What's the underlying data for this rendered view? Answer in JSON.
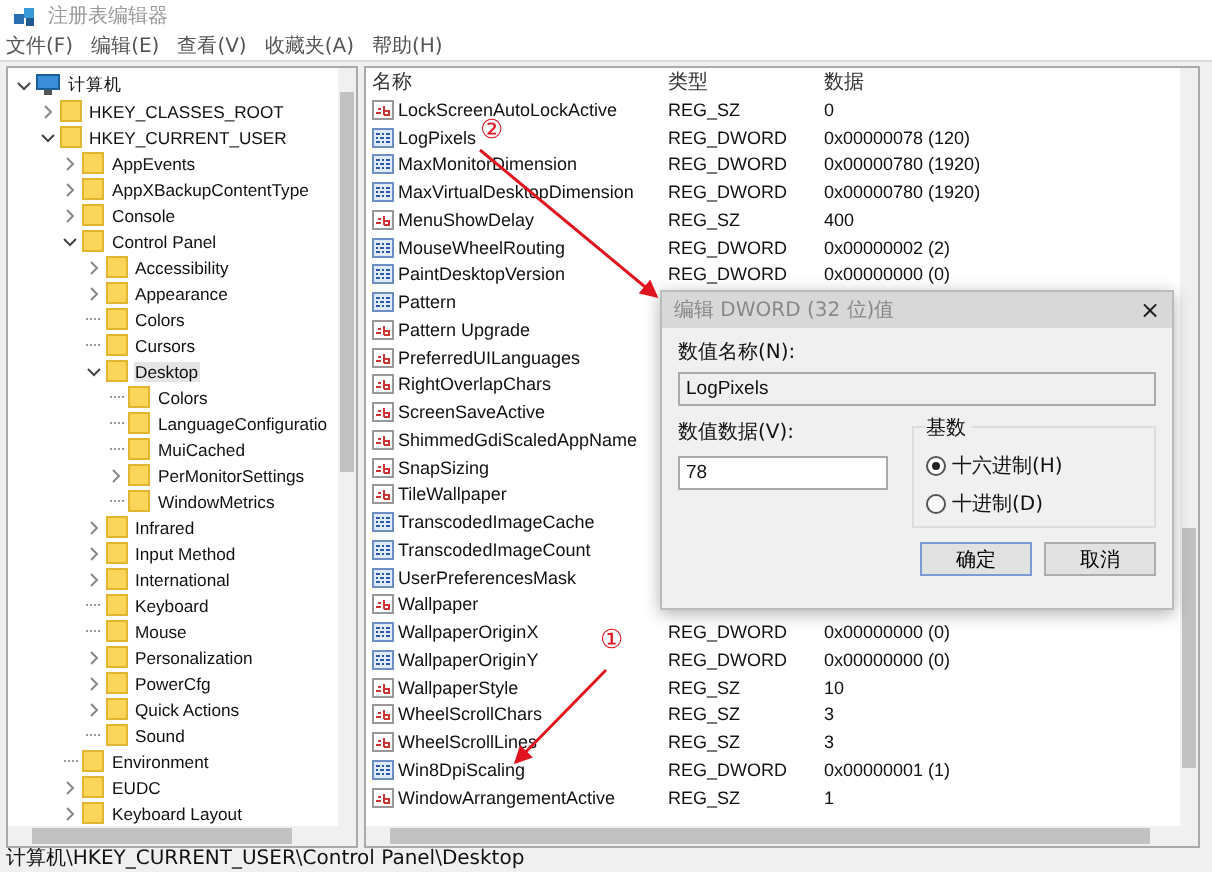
{
  "window": {
    "title": "注册表编辑器"
  },
  "menu": [
    "文件(F)",
    "编辑(E)",
    "查看(V)",
    "收藏夹(A)",
    "帮助(H)"
  ],
  "tree": [
    {
      "label": "计算机",
      "kind": "computer",
      "expandable": true,
      "expanded": true,
      "selected": false,
      "children": [
        {
          "label": "HKEY_CLASSES_ROOT",
          "kind": "folder",
          "expandable": true,
          "expanded": false,
          "selected": false
        },
        {
          "label": "HKEY_CURRENT_USER",
          "kind": "folder",
          "expandable": true,
          "expanded": true,
          "selected": false,
          "children": [
            {
              "label": "AppEvents",
              "kind": "folder",
              "expandable": true,
              "expanded": false,
              "selected": false
            },
            {
              "label": "AppXBackupContentType",
              "kind": "folder",
              "expandable": true,
              "expanded": false,
              "selected": false
            },
            {
              "label": "Console",
              "kind": "folder",
              "expandable": true,
              "expanded": false,
              "selected": false
            },
            {
              "label": "Control Panel",
              "kind": "folder",
              "expandable": true,
              "expanded": true,
              "selected": false,
              "children": [
                {
                  "label": "Accessibility",
                  "kind": "folder",
                  "expandable": true,
                  "expanded": false,
                  "selected": false
                },
                {
                  "label": "Appearance",
                  "kind": "folder",
                  "expandable": true,
                  "expanded": false,
                  "selected": false
                },
                {
                  "label": "Colors",
                  "kind": "folder",
                  "expandable": false,
                  "expanded": false,
                  "selected": false
                },
                {
                  "label": "Cursors",
                  "kind": "folder",
                  "expandable": false,
                  "expanded": false,
                  "selected": false
                },
                {
                  "label": "Desktop",
                  "kind": "folder",
                  "expandable": true,
                  "expanded": true,
                  "selected": true,
                  "children": [
                    {
                      "label": "Colors",
                      "kind": "folder",
                      "expandable": false,
                      "expanded": false,
                      "selected": false
                    },
                    {
                      "label": "LanguageConfiguratio",
                      "kind": "folder",
                      "expandable": false,
                      "expanded": false,
                      "selected": false
                    },
                    {
                      "label": "MuiCached",
                      "kind": "folder",
                      "expandable": false,
                      "expanded": false,
                      "selected": false
                    },
                    {
                      "label": "PerMonitorSettings",
                      "kind": "folder",
                      "expandable": true,
                      "expanded": false,
                      "selected": false
                    },
                    {
                      "label": "WindowMetrics",
                      "kind": "folder",
                      "expandable": false,
                      "expanded": false,
                      "selected": false
                    }
                  ]
                },
                {
                  "label": "Infrared",
                  "kind": "folder",
                  "expandable": true,
                  "expanded": false,
                  "selected": false
                },
                {
                  "label": "Input Method",
                  "kind": "folder",
                  "expandable": true,
                  "expanded": false,
                  "selected": false
                },
                {
                  "label": "International",
                  "kind": "folder",
                  "expandable": true,
                  "expanded": false,
                  "selected": false
                },
                {
                  "label": "Keyboard",
                  "kind": "folder",
                  "expandable": false,
                  "expanded": false,
                  "selected": false
                },
                {
                  "label": "Mouse",
                  "kind": "folder",
                  "expandable": false,
                  "expanded": false,
                  "selected": false
                },
                {
                  "label": "Personalization",
                  "kind": "folder",
                  "expandable": true,
                  "expanded": false,
                  "selected": false
                },
                {
                  "label": "PowerCfg",
                  "kind": "folder",
                  "expandable": true,
                  "expanded": false,
                  "selected": false
                },
                {
                  "label": "Quick Actions",
                  "kind": "folder",
                  "expandable": true,
                  "expanded": false,
                  "selected": false
                },
                {
                  "label": "Sound",
                  "kind": "folder",
                  "expandable": false,
                  "expanded": false,
                  "selected": false
                }
              ]
            },
            {
              "label": "Environment",
              "kind": "folder",
              "expandable": false,
              "expanded": false,
              "selected": false
            },
            {
              "label": "EUDC",
              "kind": "folder",
              "expandable": true,
              "expanded": false,
              "selected": false
            },
            {
              "label": "Keyboard Layout",
              "kind": "folder",
              "expandable": true,
              "expanded": false,
              "selected": false
            }
          ]
        }
      ]
    }
  ],
  "table": {
    "columns": [
      "名称",
      "类型",
      "数据"
    ],
    "rows": [
      {
        "kind": "string",
        "name": "LockScreenAutoLockActive",
        "type": "REG_SZ",
        "data": "0"
      },
      {
        "kind": "binary",
        "name": "LogPixels",
        "type": "REG_DWORD",
        "data": "0x00000078 (120)"
      },
      {
        "kind": "binary",
        "name": "MaxMonitorDimension",
        "type": "REG_DWORD",
        "data": "0x00000780 (1920)"
      },
      {
        "kind": "binary",
        "name": "MaxVirtualDesktopDimension",
        "type": "REG_DWORD",
        "data": "0x00000780 (1920)"
      },
      {
        "kind": "string",
        "name": "MenuShowDelay",
        "type": "REG_SZ",
        "data": "400"
      },
      {
        "kind": "binary",
        "name": "MouseWheelRouting",
        "type": "REG_DWORD",
        "data": "0x00000002 (2)"
      },
      {
        "kind": "binary",
        "name": "PaintDesktopVersion",
        "type": "REG_DWORD",
        "data": "0x00000000 (0)"
      },
      {
        "kind": "binary",
        "name": "Pattern"
      },
      {
        "kind": "string",
        "name": "Pattern Upgrade"
      },
      {
        "kind": "string",
        "name": "PreferredUILanguages"
      },
      {
        "kind": "string",
        "name": "RightOverlapChars"
      },
      {
        "kind": "string",
        "name": "ScreenSaveActive"
      },
      {
        "kind": "string",
        "name": "ShimmedGdiScaledAppName"
      },
      {
        "kind": "string",
        "name": "SnapSizing"
      },
      {
        "kind": "string",
        "name": "TileWallpaper"
      },
      {
        "kind": "binary",
        "name": "TranscodedImageCache"
      },
      {
        "kind": "binary",
        "name": "TranscodedImageCount"
      },
      {
        "kind": "binary",
        "name": "UserPreferencesMask"
      },
      {
        "kind": "string",
        "name": "Wallpaper"
      },
      {
        "kind": "binary",
        "name": "WallpaperOriginX",
        "type": "REG_DWORD",
        "data": "0x00000000 (0)"
      },
      {
        "kind": "binary",
        "name": "WallpaperOriginY",
        "type": "REG_DWORD",
        "data": "0x00000000 (0)"
      },
      {
        "kind": "string",
        "name": "WallpaperStyle",
        "type": "REG_SZ",
        "data": "10"
      },
      {
        "kind": "string",
        "name": "WheelScrollChars",
        "type": "REG_SZ",
        "data": "3"
      },
      {
        "kind": "string",
        "name": "WheelScrollLines",
        "type": "REG_SZ",
        "data": "3"
      },
      {
        "kind": "binary",
        "name": "Win8DpiScaling",
        "type": "REG_DWORD",
        "data": "0x00000001 (1)"
      },
      {
        "kind": "string",
        "name": "WindowArrangementActive",
        "type": "REG_SZ",
        "data": "1"
      }
    ]
  },
  "dialog": {
    "title": "编辑 DWORD (32 位)值",
    "close": "×",
    "name_label": "数值名称(N):",
    "name_value": "LogPixels",
    "data_label": "数值数据(V):",
    "data_value": "78",
    "base_label": "基数",
    "bases": [
      {
        "label": "十六进制(H)",
        "selected": true
      },
      {
        "label": "十进制(D)",
        "selected": false
      }
    ],
    "buttons": [
      "确定",
      "取消"
    ]
  },
  "annotations": [
    {
      "mark": "②"
    },
    {
      "mark": "①"
    }
  ],
  "status_bar": {
    "path": "计算机\\HKEY_CURRENT_USER\\Control Panel\\Desktop"
  }
}
